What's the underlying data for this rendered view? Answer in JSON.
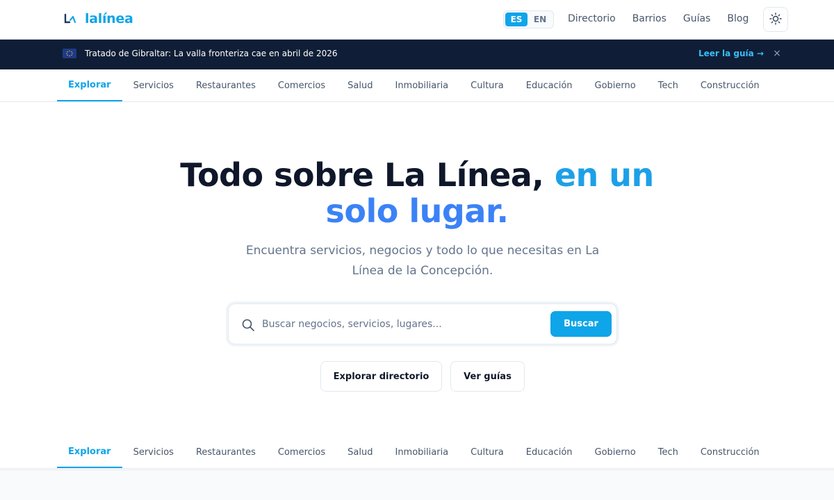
{
  "header": {
    "logo_text": "lalínea",
    "lang": {
      "es": "ES",
      "en": "EN",
      "active": "ES"
    },
    "nav": [
      "Directorio",
      "Barrios",
      "Guías",
      "Blog"
    ],
    "theme_icon": "sun-icon"
  },
  "banner": {
    "flag_icon": "eu-flag-icon",
    "text": "Tratado de Gibraltar: La valla fronteriza cae en abril de 2026",
    "link": "Leer la guía →",
    "close": "×"
  },
  "categories": [
    "Explorar",
    "Servicios",
    "Restaurantes",
    "Comercios",
    "Salud",
    "Inmobiliaria",
    "Cultura",
    "Educación",
    "Gobierno",
    "Tech",
    "Construcción"
  ],
  "active_category": "Explorar",
  "hero": {
    "title_part1": "Todo sobre La Línea,",
    "title_accent1": "en un",
    "title_accent2": "solo lugar.",
    "subtitle": "Encuentra servicios, negocios y todo lo que necesitas en La Línea de la Concepción."
  },
  "search": {
    "placeholder": "Buscar negocios, servicios, lugares...",
    "value": "",
    "button": "Buscar"
  },
  "actions": {
    "explore": "Explorar directorio",
    "guides": "Ver guías"
  },
  "colors": {
    "accent": "#0ea5e9",
    "banner_bg": "#0f1e36",
    "title": "#0f172a"
  }
}
